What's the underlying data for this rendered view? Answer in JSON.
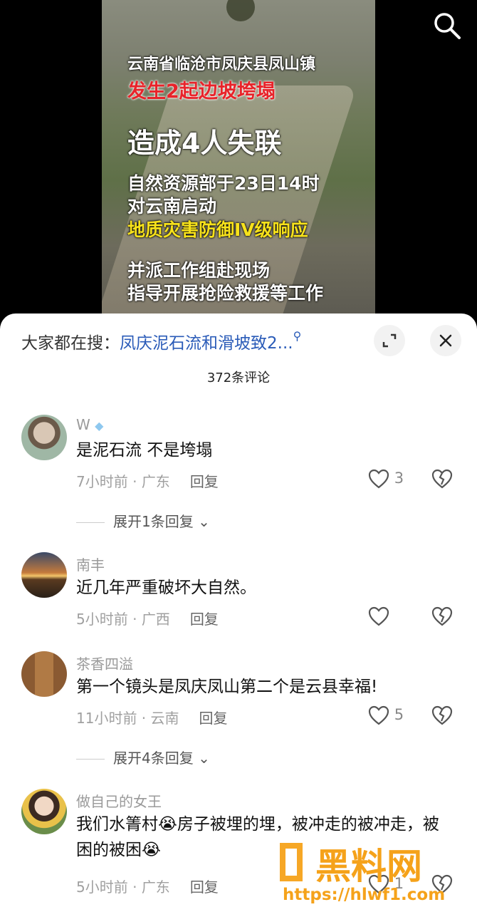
{
  "video": {
    "line1": "云南省临沧市凤庆县凤山镇",
    "line2": "发生2起边坡垮塌",
    "line3": "造成4人失联",
    "line4": "自然资源部于23日14时",
    "line5": "对云南启动",
    "line6": "地质灾害防御IV级响应",
    "line7": "并派工作组赴现场",
    "line8": "指导开展抢险救援等工作"
  },
  "sheet": {
    "search_prefix": "大家都在搜：",
    "search_keyword": "凤庆泥石流和滑坡致2...",
    "comment_count": "372条评论"
  },
  "comments": [
    {
      "user": "W",
      "text": "是泥石流 不是垮塌",
      "time": "7小时前",
      "location": "广东",
      "reply": "回复",
      "likes": "3",
      "expand": "展开1条回复"
    },
    {
      "user": "南丰",
      "text": "近几年严重破坏大自然。",
      "time": "5小时前",
      "location": "广西",
      "reply": "回复",
      "likes": ""
    },
    {
      "user": "茶香四溢",
      "text": "第一个镜头是凤庆凤山第二个是云县幸福!",
      "time": "11小时前",
      "location": "云南",
      "reply": "回复",
      "likes": "5",
      "expand": "展开4条回复"
    },
    {
      "user": "做自己的女王",
      "text": "我们水箐村😭房子被埋的埋，被冲走的被冲走，被困的被困😭",
      "time": "5小时前",
      "location": "广东",
      "reply": "回复",
      "likes": "1"
    }
  ],
  "watermark": {
    "brand": "黑料网",
    "url": "https://hlwf1.com"
  },
  "colors": {
    "accent": "#2a5bb8",
    "red_text": "#e8232a",
    "yellow_text": "#f7e21b",
    "watermark": "#f5a21a"
  }
}
